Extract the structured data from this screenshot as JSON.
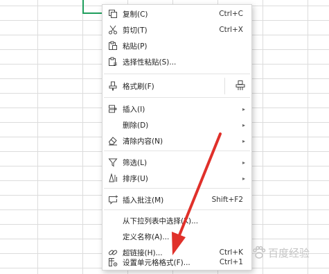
{
  "menu": {
    "items": [
      {
        "label": "复制(C)",
        "shortcut": "Ctrl+C",
        "icon": "copy-icon"
      },
      {
        "label": "剪切(T)",
        "shortcut": "Ctrl+X",
        "icon": "scissors-icon"
      },
      {
        "label": "粘贴(P)",
        "icon": "paste-icon"
      },
      {
        "label": "选择性粘贴(S)...",
        "icon": "paste-special-icon"
      },
      {
        "label": "格式刷(F)",
        "icon": "format-brush-icon"
      },
      {
        "label": "插入(I)",
        "icon": "insert-icon",
        "submenu": true
      },
      {
        "label": "删除(D)",
        "submenu": true
      },
      {
        "label": "清除内容(N)",
        "icon": "eraser-icon",
        "submenu": true
      },
      {
        "label": "筛选(L)",
        "icon": "filter-icon",
        "submenu": true
      },
      {
        "label": "排序(U)",
        "icon": "sort-icon",
        "submenu": true
      },
      {
        "label": "插入批注(M)",
        "shortcut": "Shift+F2",
        "icon": "comment-icon"
      },
      {
        "label": "从下拉列表中选择(K)..."
      },
      {
        "label": "定义名称(A)..."
      },
      {
        "label": "超链接(H)...",
        "shortcut": "Ctrl+K",
        "icon": "link-icon"
      },
      {
        "label": "设置单元格格式(F)...",
        "shortcut": "Ctrl+1",
        "icon": "format-cells-icon"
      }
    ]
  },
  "watermark": {
    "text": "百度经验"
  },
  "colors": {
    "selection": "#1e9e5c",
    "arrow": "#e0302a",
    "menu_border": "#d6d6d6"
  }
}
